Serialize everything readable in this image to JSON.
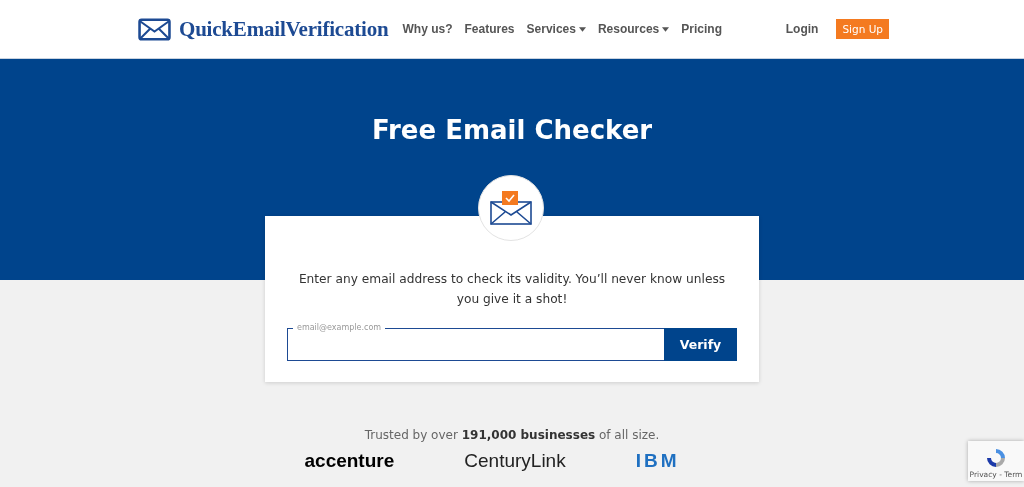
{
  "header": {
    "logo": "QuickEmailVerification",
    "nav": [
      {
        "label": "Why us?",
        "has_menu": false
      },
      {
        "label": "Features",
        "has_menu": false
      },
      {
        "label": "Services",
        "has_menu": true
      },
      {
        "label": "Resources",
        "has_menu": true
      },
      {
        "label": "Pricing",
        "has_menu": false
      }
    ],
    "login": "Login",
    "signup": "Sign Up"
  },
  "hero": {
    "title": "Free Email Checker"
  },
  "checker": {
    "text": "Enter any email address to check its validity. You’ll never know unless you give it a shot!",
    "field_label": "email@example.com",
    "button": "Verify"
  },
  "trusted": {
    "text": "Trusted by over **191,000 businesses** of all size.",
    "logos": [
      "accenture",
      "CenturyLink",
      "IBM"
    ]
  },
  "recaptcha": {
    "links": "Privacy - Term"
  }
}
